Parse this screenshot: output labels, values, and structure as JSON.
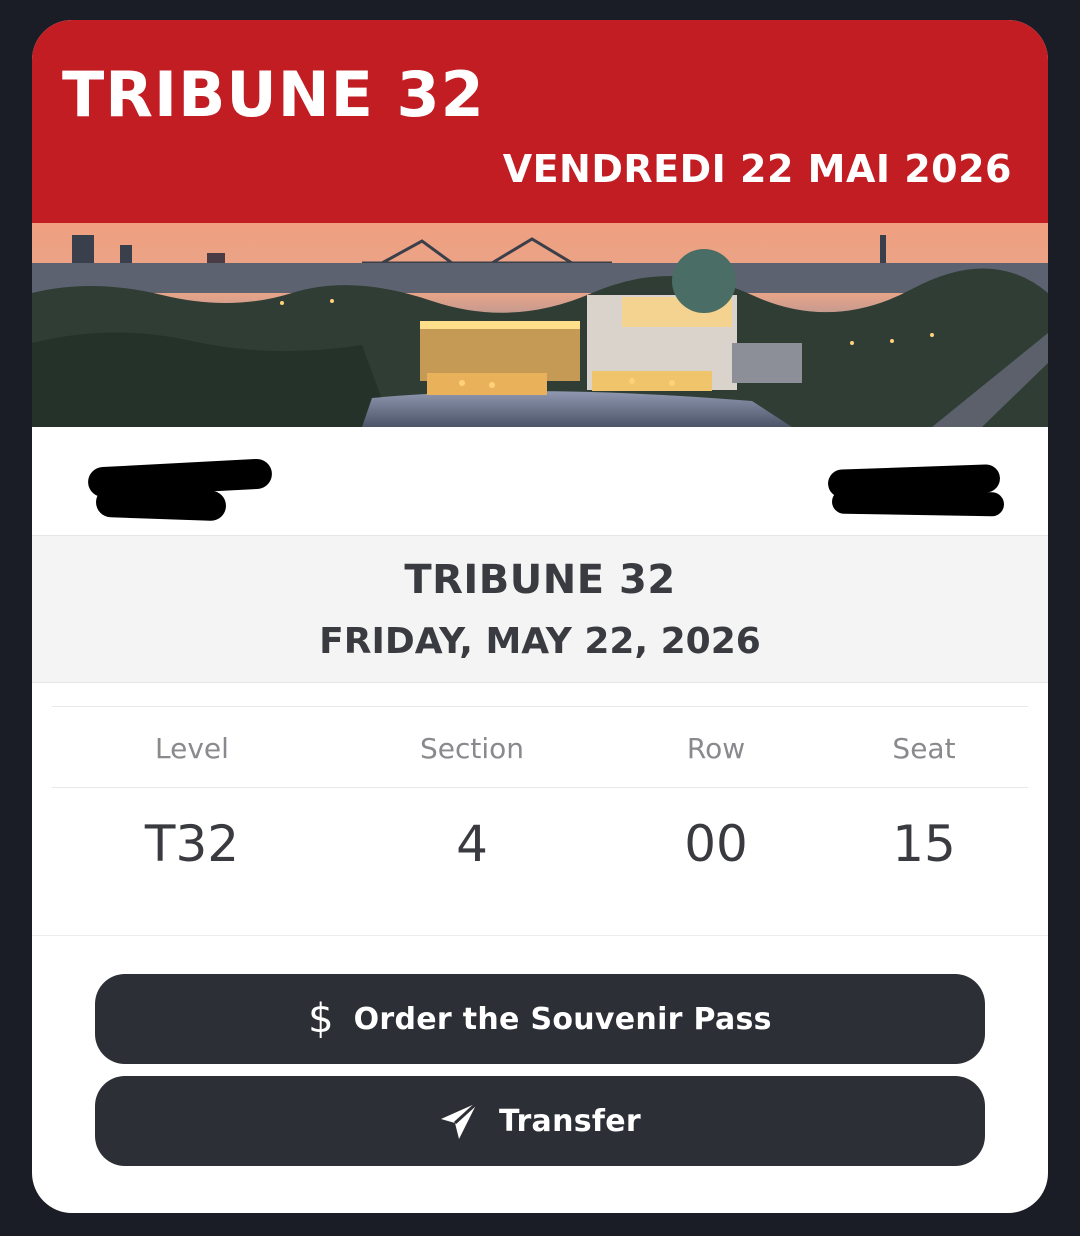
{
  "banner": {
    "title": "TRIBUNE 32",
    "date_fr": "VENDREDI 22 MAI 2026",
    "color": "#c11d23"
  },
  "event": {
    "title": "TRIBUNE 32",
    "date": "FRIDAY, MAY 22, 2026"
  },
  "seat": {
    "headers": [
      "Level",
      "Section",
      "Row",
      "Seat"
    ],
    "values": [
      "T32",
      "4",
      "00",
      "15"
    ]
  },
  "actions": {
    "souvenir_label": "Order the Souvenir Pass",
    "souvenir_icon": "dollar-icon",
    "transfer_label": "Transfer",
    "transfer_icon": "paper-plane-icon",
    "button_color": "#2d2f36"
  }
}
